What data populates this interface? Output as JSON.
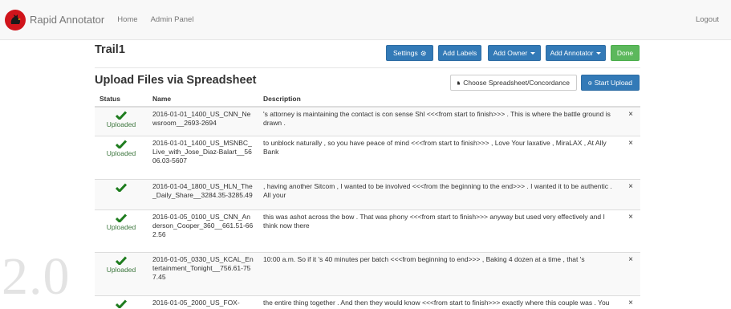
{
  "navbar": {
    "brand": "Rapid Annotator",
    "links": [
      "Home",
      "Admin Panel"
    ],
    "logout": "Logout",
    "brand_color": "#d0141b"
  },
  "experiment": {
    "title": "Trail1",
    "buttons": {
      "settings": "Settings",
      "add_labels": "Add Labels",
      "add_owner": "Add Owner",
      "add_annotator": "Add Annotator",
      "done": "Done"
    }
  },
  "upload": {
    "title": "Upload Files via Spreadsheet",
    "choose_button": "Choose Spreadsheet/Concordance",
    "start_button": "Start Upload"
  },
  "table": {
    "headers": {
      "status": "Status",
      "name": "Name",
      "description": "Description"
    },
    "rows": [
      {
        "status": "Uploaded",
        "name": "2016-01-01_1400_US_CNN_Newsroom__2693-2694",
        "description": "'s attorney is maintaining the contact is con sense Shl <<<from start to finish>>> . This is where the battle ground is drawn .",
        "remove": "×"
      },
      {
        "status": "Uploaded",
        "name": "2016-01-01_1400_US_MSNBC_Live_with_Jose_Diaz-Balart__5606.03-5607",
        "description": "to unblock naturally , so you have peace of mind <<<from start to finish>>> , Love Your laxative , MiraLAX , At Ally Bank",
        "remove": "×"
      },
      {
        "status": "",
        "name": "2016-01-04_1800_US_HLN_The_Daily_Share__3284.35-3285.49",
        "description": ", having another Sitcom , I wanted to be involved <<<from the beginning to the end>>> . I wanted it to be authentic . All your",
        "remove": "×"
      },
      {
        "status": "Uploaded",
        "name": "2016-01-05_0100_US_CNN_Anderson_Cooper_360__661.51-662.56",
        "description": "this was ashot across the bow . That was phony <<<from start to finish>>> anyway but used very effectively and I think now there",
        "remove": "×"
      },
      {
        "status": "Uploaded",
        "name": "2016-01-05_0330_US_KCAL_Entertainment_Tonight__756.61-757.45",
        "description": "10:00 a.m. So if it 's 40 minutes per batch <<<from beginning to end>>> , Baking 4 dozen at a time , that 's",
        "remove": "×"
      },
      {
        "status": "",
        "name": "2016-01-05_2000_US_FOX-",
        "description": "the entire thing together . And then they would know <<<from start to finish>>> exactly where this couple was . You",
        "remove": "×"
      }
    ]
  },
  "watermark": "2.0",
  "colors": {
    "primary": "#337ab7",
    "success": "#5cb85c",
    "check": "#1e7c1e"
  }
}
